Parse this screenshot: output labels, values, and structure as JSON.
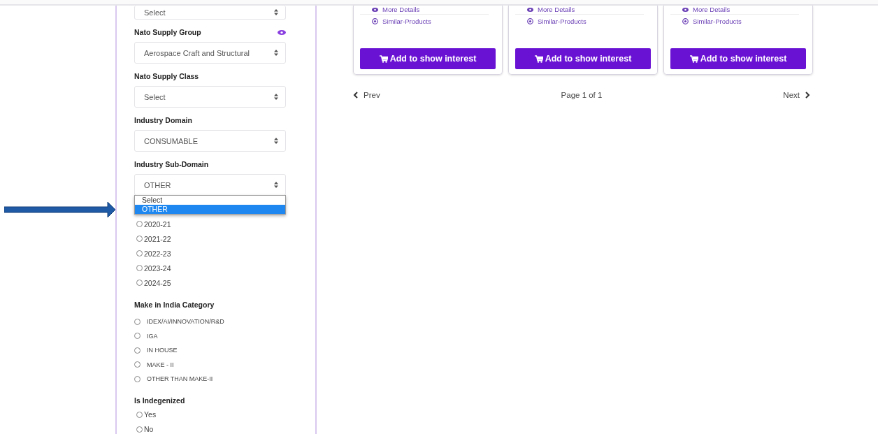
{
  "filters": [
    {
      "value": "Select",
      "open": false
    },
    {
      "label": "Nato Supply Group",
      "value": "Aerospace Craft and Structural",
      "eye_icon": true,
      "open": false
    },
    {
      "label": "Nato Supply Class",
      "value": "Select",
      "eye_icon": false,
      "open": false
    },
    {
      "label": "Industry Domain",
      "value": "CONSUMABLE",
      "eye_icon": false,
      "open": false
    },
    {
      "label": "Industry Sub-Domain",
      "value": "OTHER",
      "eye_icon": false,
      "open": true
    }
  ],
  "dropdown_options": [
    {
      "label": "Select",
      "selected": false
    },
    {
      "label": "OTHER",
      "selected": true
    }
  ],
  "years": [
    {
      "label": "2020-21",
      "checked": false
    },
    {
      "label": "2021-22",
      "checked": false
    },
    {
      "label": "2022-23",
      "checked": false
    },
    {
      "label": "2023-24",
      "checked": false
    },
    {
      "label": "2024-25",
      "checked": false
    }
  ],
  "make_in_india": {
    "label": "Make in India Category",
    "options": [
      {
        "label": "IDEX/AI/INNOVATION/R&D",
        "checked": false
      },
      {
        "label": "IGA",
        "checked": false
      },
      {
        "label": "IN HOUSE",
        "checked": false
      },
      {
        "label": "MAKE - II",
        "checked": false
      },
      {
        "label": "OTHER THAN MAKE-II",
        "checked": false
      }
    ]
  },
  "indegenized": {
    "label": "Is Indegenized",
    "options": [
      {
        "label": "Yes",
        "checked": false
      },
      {
        "label": "No",
        "checked": false
      }
    ]
  },
  "cards": [
    {
      "more_details": "More Details",
      "similar": "Similar-Products",
      "button": "Add to show interest"
    },
    {
      "more_details": "More Details",
      "similar": "Similar-Products",
      "button": "Add to show interest"
    },
    {
      "more_details": "More Details",
      "similar": "Similar-Products",
      "button": "Add to show interest"
    }
  ],
  "pagination": {
    "prev": "Prev",
    "page": "Page 1 of 1",
    "next": "Next"
  }
}
